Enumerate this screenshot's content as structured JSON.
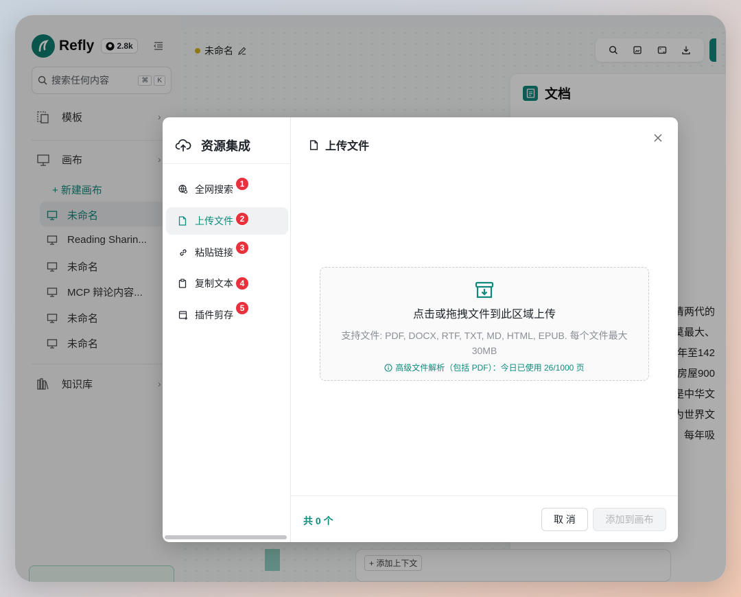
{
  "app": {
    "name": "Refly",
    "github_stars": "2.8k"
  },
  "sidebar": {
    "search_placeholder": "搜索任何内容",
    "shortcut_keys": [
      "⌘",
      "K"
    ],
    "templates_label": "模板",
    "canvas_label": "画布",
    "new_canvas_label": "+ 新建画布",
    "canvases": [
      {
        "label": "未命名",
        "active": true
      },
      {
        "label": "Reading Sharin...",
        "active": false
      },
      {
        "label": "未命名",
        "active": false
      },
      {
        "label": "MCP 辩论内容...",
        "active": false
      },
      {
        "label": "未命名",
        "active": false
      },
      {
        "label": "未命名",
        "active": false
      }
    ],
    "knowledge_label": "知识库"
  },
  "canvas": {
    "title": "未命名",
    "doc_panel_title": "文档",
    "doc_snippets": [
      "清两代的",
      "莫最大、",
      "年至142",
      "房屋900",
      "是中华文",
      "为世界文",
      "每年吸"
    ],
    "add_context_label": "+ 添加上下文"
  },
  "modal": {
    "title": "资源集成",
    "menu": [
      {
        "label": "全网搜索",
        "badge": "1",
        "icon": "globe-search-icon"
      },
      {
        "label": "上传文件",
        "badge": "2",
        "icon": "file-icon"
      },
      {
        "label": "粘贴链接",
        "badge": "3",
        "icon": "link-icon"
      },
      {
        "label": "复制文本",
        "badge": "4",
        "icon": "clipboard-icon"
      },
      {
        "label": "插件剪存",
        "badge": "5",
        "icon": "browser-clip-icon"
      }
    ],
    "active_title": "上传文件",
    "dropzone": {
      "main_text": "点击或拖拽文件到此区域上传",
      "sub_text": "支持文件: PDF, DOCX, RTF, TXT, MD, HTML, EPUB. 每个文件最大 30MB",
      "info_text": "高级文件解析（包括 PDF）：今日已使用 26/1000 页"
    },
    "count_text": "共 0 个",
    "cancel_label": "取 消",
    "add_label": "添加到画布"
  },
  "colors": {
    "accent": "#0e8a7c",
    "badge": "#e8313c",
    "status_dot": "#d4b020"
  }
}
